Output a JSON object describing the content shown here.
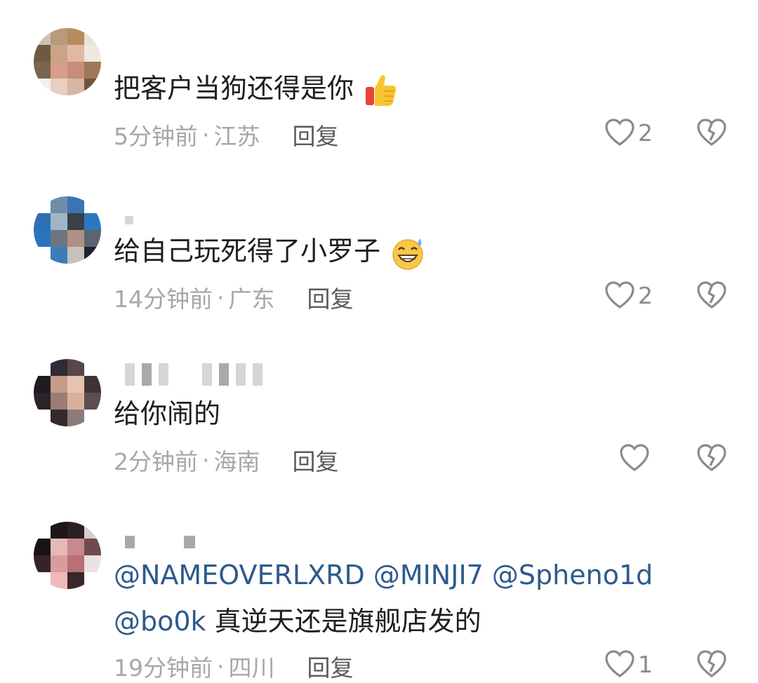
{
  "comments": [
    {
      "text": "把客户当狗还得是你",
      "emoji": "thumbs-up",
      "time": "5分钟前",
      "location": "江苏",
      "reply_label": "回复",
      "likes": "2"
    },
    {
      "text": "给自己玩死得了小罗子",
      "emoji": "grinning-sweat",
      "time": "14分钟前",
      "location": "广东",
      "reply_label": "回复",
      "likes": "2"
    },
    {
      "text": "给你闹的",
      "time": "2分钟前",
      "location": "海南",
      "reply_label": "回复",
      "likes": ""
    },
    {
      "mentions_line1": "@NAMEOVERLXRD @MINJI7 @Spheno1d",
      "mention_line2": "@bo0k",
      "text_line2": " 真逆天还是旗舰店发的",
      "time": "19分钟前",
      "location": "四川",
      "reply_label": "回复",
      "likes": "1"
    }
  ],
  "separator": "·",
  "icons": {
    "like": "heart-outline-icon",
    "dislike": "broken-heart-icon"
  },
  "colors": {
    "mention": "#2d5a8c",
    "meta": "#a7a7a7",
    "text": "#1e1e1e"
  }
}
